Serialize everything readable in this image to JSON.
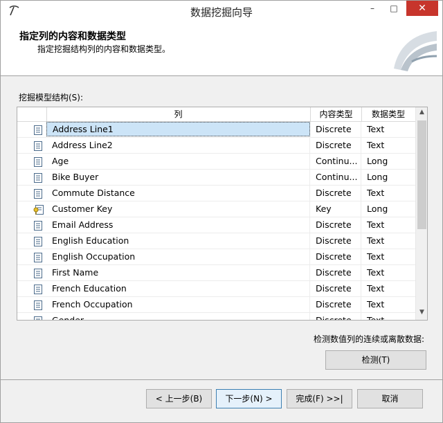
{
  "window": {
    "title": "数据挖掘向导",
    "min_glyph": "–",
    "max_glyph": "□",
    "close_glyph": "✕"
  },
  "header": {
    "title": "指定列的内容和数据类型",
    "subtitle": "指定挖掘结构列的内容和数据类型。"
  },
  "structure_label": "挖掘模型结构(S):",
  "grid": {
    "headers": {
      "column": "列",
      "content_type": "内容类型",
      "data_type": "数据类型"
    },
    "rows": [
      {
        "icon": "column-icon",
        "column": "Address Line1",
        "content_type": "Discrete",
        "data_type": "Text"
      },
      {
        "icon": "column-icon",
        "column": "Address Line2",
        "content_type": "Discrete",
        "data_type": "Text"
      },
      {
        "icon": "column-icon",
        "column": "Age",
        "content_type": "Continu...",
        "data_type": "Long"
      },
      {
        "icon": "column-icon",
        "column": "Bike Buyer",
        "content_type": "Continu...",
        "data_type": "Long"
      },
      {
        "icon": "column-icon",
        "column": "Commute Distance",
        "content_type": "Discrete",
        "data_type": "Text"
      },
      {
        "icon": "key-column-icon",
        "column": "Customer Key",
        "content_type": "Key",
        "data_type": "Long"
      },
      {
        "icon": "column-icon",
        "column": "Email Address",
        "content_type": "Discrete",
        "data_type": "Text"
      },
      {
        "icon": "column-icon",
        "column": "English Education",
        "content_type": "Discrete",
        "data_type": "Text"
      },
      {
        "icon": "column-icon",
        "column": "English Occupation",
        "content_type": "Discrete",
        "data_type": "Text"
      },
      {
        "icon": "column-icon",
        "column": "First Name",
        "content_type": "Discrete",
        "data_type": "Text"
      },
      {
        "icon": "column-icon",
        "column": "French Education",
        "content_type": "Discrete",
        "data_type": "Text"
      },
      {
        "icon": "column-icon",
        "column": "French Occupation",
        "content_type": "Discrete",
        "data_type": "Text"
      },
      {
        "icon": "column-icon",
        "column": "Gender",
        "content_type": "Discrete",
        "data_type": "Text"
      }
    ]
  },
  "detect": {
    "label": "检测数值列的连续或离散数据:",
    "button": "检测(T)"
  },
  "footer": {
    "prev": "< 上一步(B)",
    "next": "下一步(N) >",
    "finish": "完成(F) >>|",
    "cancel": "取消"
  },
  "colors": {
    "selection": "#cce4f7",
    "close_button": "#c7352c",
    "default_button_border": "#3c7fb1"
  }
}
